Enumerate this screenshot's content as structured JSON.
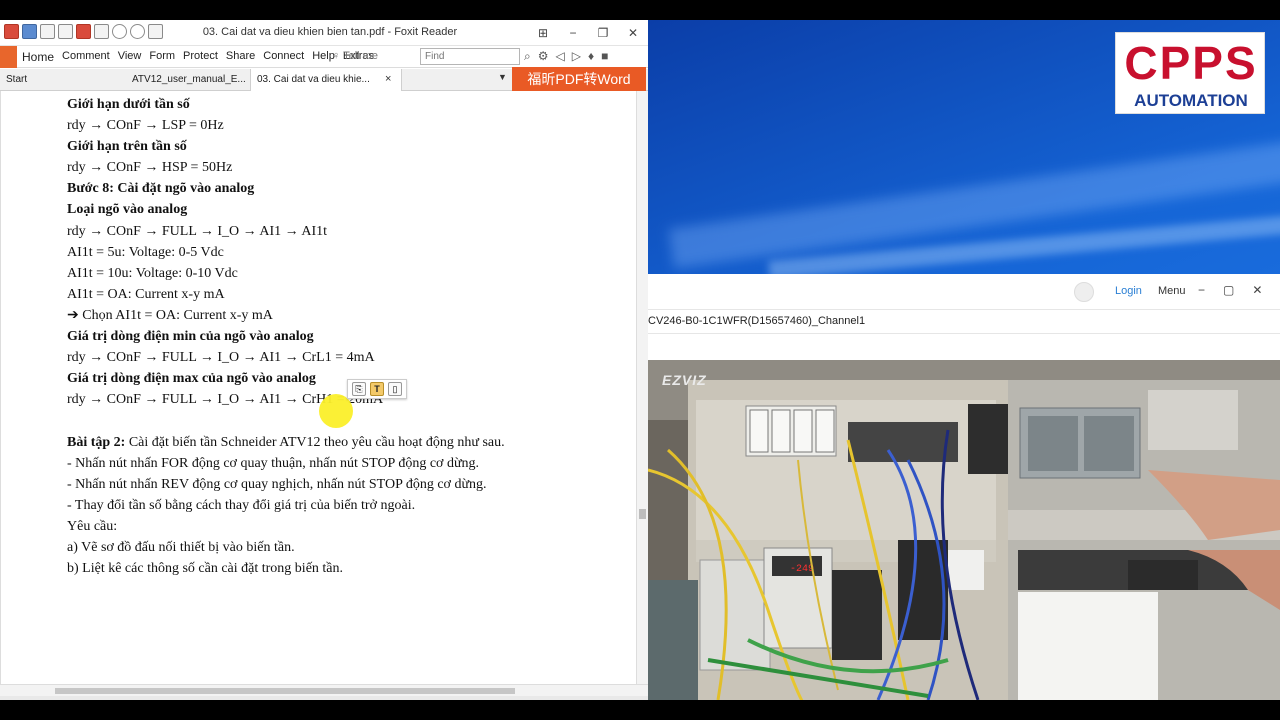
{
  "foxit": {
    "title": "03. Cai dat va dieu khien bien tan.pdf - Foxit Reader",
    "menus": [
      "Home",
      "Comment",
      "View",
      "Form",
      "Protect",
      "Share",
      "Connect",
      "Help",
      "Extras"
    ],
    "tell_me": "Tell me",
    "find_placeholder": "Find",
    "tabs": {
      "start": "Start",
      "tab1": "ATV12_user_manual_E...",
      "tab2": "03. Cai dat va dieu khie..."
    },
    "promo": "福昕PDF转Word",
    "tab_close": "×",
    "tab_dropdown": "▼"
  },
  "doc": {
    "lines": [
      {
        "t": "Giới hạn dưới tần số",
        "b": true
      },
      {
        "t": "rdy → COnF → LSP = 0Hz",
        "b": false
      },
      {
        "t": "Giới hạn trên tần số",
        "b": true
      },
      {
        "t": "rdy → COnF → HSP = 50Hz",
        "b": false
      },
      {
        "t": "Bước 8: Cài đặt ngõ vào analog",
        "b": true
      },
      {
        "t": "Loại ngõ vào analog",
        "b": true
      },
      {
        "t": "rdy → COnF → FULL → I_O → AI1 → AI1t",
        "b": false
      },
      {
        "t": "AI1t = 5u: Voltage: 0-5 Vdc",
        "b": false
      },
      {
        "t": "AI1t = 10u: Voltage: 0-10 Vdc",
        "b": false
      },
      {
        "t": "AI1t = OA: Current x-y mA",
        "b": false
      },
      {
        "t": "➔  Chọn AI1t = OA: Current x-y mA",
        "b": false
      },
      {
        "t": "Giá trị dòng điện min của ngõ vào analog",
        "b": true
      },
      {
        "t": "rdy → COnF → FULL → I_O → AI1 → CrL1 = 4mA",
        "b": false
      },
      {
        "t": "Giá trị dòng điện max của ngõ vào analog",
        "b": true
      },
      {
        "t": "rdy → COnF → FULL → I_O → AI1 → CrH1 = 20mA",
        "b": false
      },
      {
        "t": "",
        "b": false
      },
      {
        "t": "Cài đặt biến tần Schneider ATV12 theo yêu cầu hoạt động như sau.",
        "b": false,
        "prefix": "Bài tập 2: "
      },
      {
        "t": "- Nhấn nút nhấn FOR động cơ quay thuận, nhấn nút STOP động cơ dừng.",
        "b": false
      },
      {
        "t": "- Nhấn nút nhấn REV động cơ quay nghịch, nhấn nút STOP động cơ dừng.",
        "b": false
      },
      {
        "t": "- Thay đổi tần số bằng cách thay đổi giá trị của biến trở ngoài.",
        "b": false
      },
      {
        "t": "Yêu cầu:",
        "b": false
      },
      {
        "t": "a) Vẽ sơ đồ đấu nối thiết bị vào biến tần.",
        "b": false
      },
      {
        "t": "b) Liệt kê các thông số cần cài đặt trong biến tần.",
        "b": false
      }
    ]
  },
  "logo": {
    "main": "CPPS",
    "sub": "AUTOMATION"
  },
  "viewer": {
    "login": "Login",
    "menu": "Menu",
    "channel": "CV246-B0-1C1WFR(D15657460)_Channel1",
    "watermark": "EZVIZ",
    "vfd_display": "-249"
  },
  "colors": {
    "foxit_orange": "#e8662c",
    "promo_bg": "#e95a25",
    "logo_red": "#c8102e",
    "logo_blue": "#1c3f95",
    "login_blue": "#2a7fd4"
  }
}
